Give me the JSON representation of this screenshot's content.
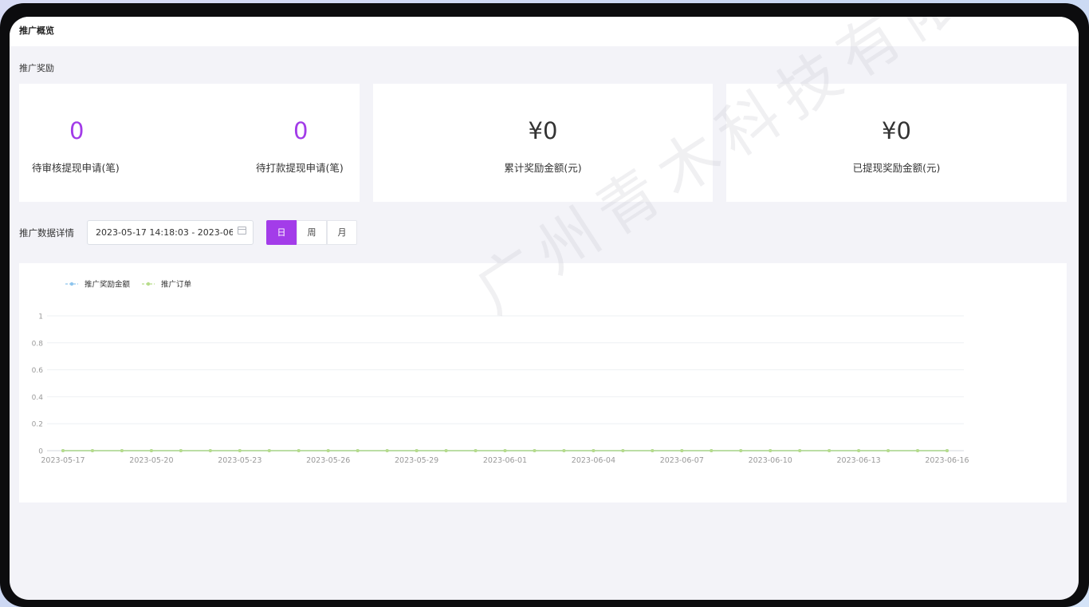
{
  "header": {
    "title": "推广概览"
  },
  "rewards": {
    "section_title": "推广奖励",
    "pending_review": {
      "value": "0",
      "label": "待审核提现申请(笔)"
    },
    "pending_payment": {
      "value": "0",
      "label": "待打款提现申请(笔)"
    },
    "total_reward": {
      "value": "¥0",
      "label": "累计奖励金额(元)"
    },
    "withdrawn_reward": {
      "value": "¥0",
      "label": "已提现奖励金额(元)"
    }
  },
  "details": {
    "label": "推广数据详情",
    "date_range": "2023-05-17 14:18:03 - 2023-06",
    "tabs": [
      {
        "label": "日",
        "active": true
      },
      {
        "label": "周",
        "active": false
      },
      {
        "label": "月",
        "active": false
      }
    ]
  },
  "colors": {
    "accent": "#a33ce9",
    "series_amount": "#8ec5ee",
    "series_orders": "#b7dc8a"
  },
  "watermark": "广州青木科技有限公",
  "chart_data": {
    "type": "line",
    "x_ticks": [
      "2023-05-17",
      "2023-05-20",
      "2023-05-23",
      "2023-05-26",
      "2023-05-29",
      "2023-06-01",
      "2023-06-04",
      "2023-06-07",
      "2023-06-10",
      "2023-06-13",
      "2023-06-16"
    ],
    "x": [
      "2023-05-17",
      "2023-05-18",
      "2023-05-19",
      "2023-05-20",
      "2023-05-21",
      "2023-05-22",
      "2023-05-23",
      "2023-05-24",
      "2023-05-25",
      "2023-05-26",
      "2023-05-27",
      "2023-05-28",
      "2023-05-29",
      "2023-05-30",
      "2023-05-31",
      "2023-06-01",
      "2023-06-02",
      "2023-06-03",
      "2023-06-04",
      "2023-06-05",
      "2023-06-06",
      "2023-06-07",
      "2023-06-08",
      "2023-06-09",
      "2023-06-10",
      "2023-06-11",
      "2023-06-12",
      "2023-06-13",
      "2023-06-14",
      "2023-06-15",
      "2023-06-16"
    ],
    "series": [
      {
        "name": "推广奖励金额",
        "values": [
          0,
          0,
          0,
          0,
          0,
          0,
          0,
          0,
          0,
          0,
          0,
          0,
          0,
          0,
          0,
          0,
          0,
          0,
          0,
          0,
          0,
          0,
          0,
          0,
          0,
          0,
          0,
          0,
          0,
          0,
          0
        ]
      },
      {
        "name": "推广订单",
        "values": [
          0,
          0,
          0,
          0,
          0,
          0,
          0,
          0,
          0,
          0,
          0,
          0,
          0,
          0,
          0,
          0,
          0,
          0,
          0,
          0,
          0,
          0,
          0,
          0,
          0,
          0,
          0,
          0,
          0,
          0,
          0
        ]
      }
    ],
    "y_ticks": [
      "0",
      "0.2",
      "0.4",
      "0.6",
      "0.8",
      "1"
    ],
    "ylim": [
      0,
      1
    ],
    "grid": true,
    "legend": "top-left"
  }
}
